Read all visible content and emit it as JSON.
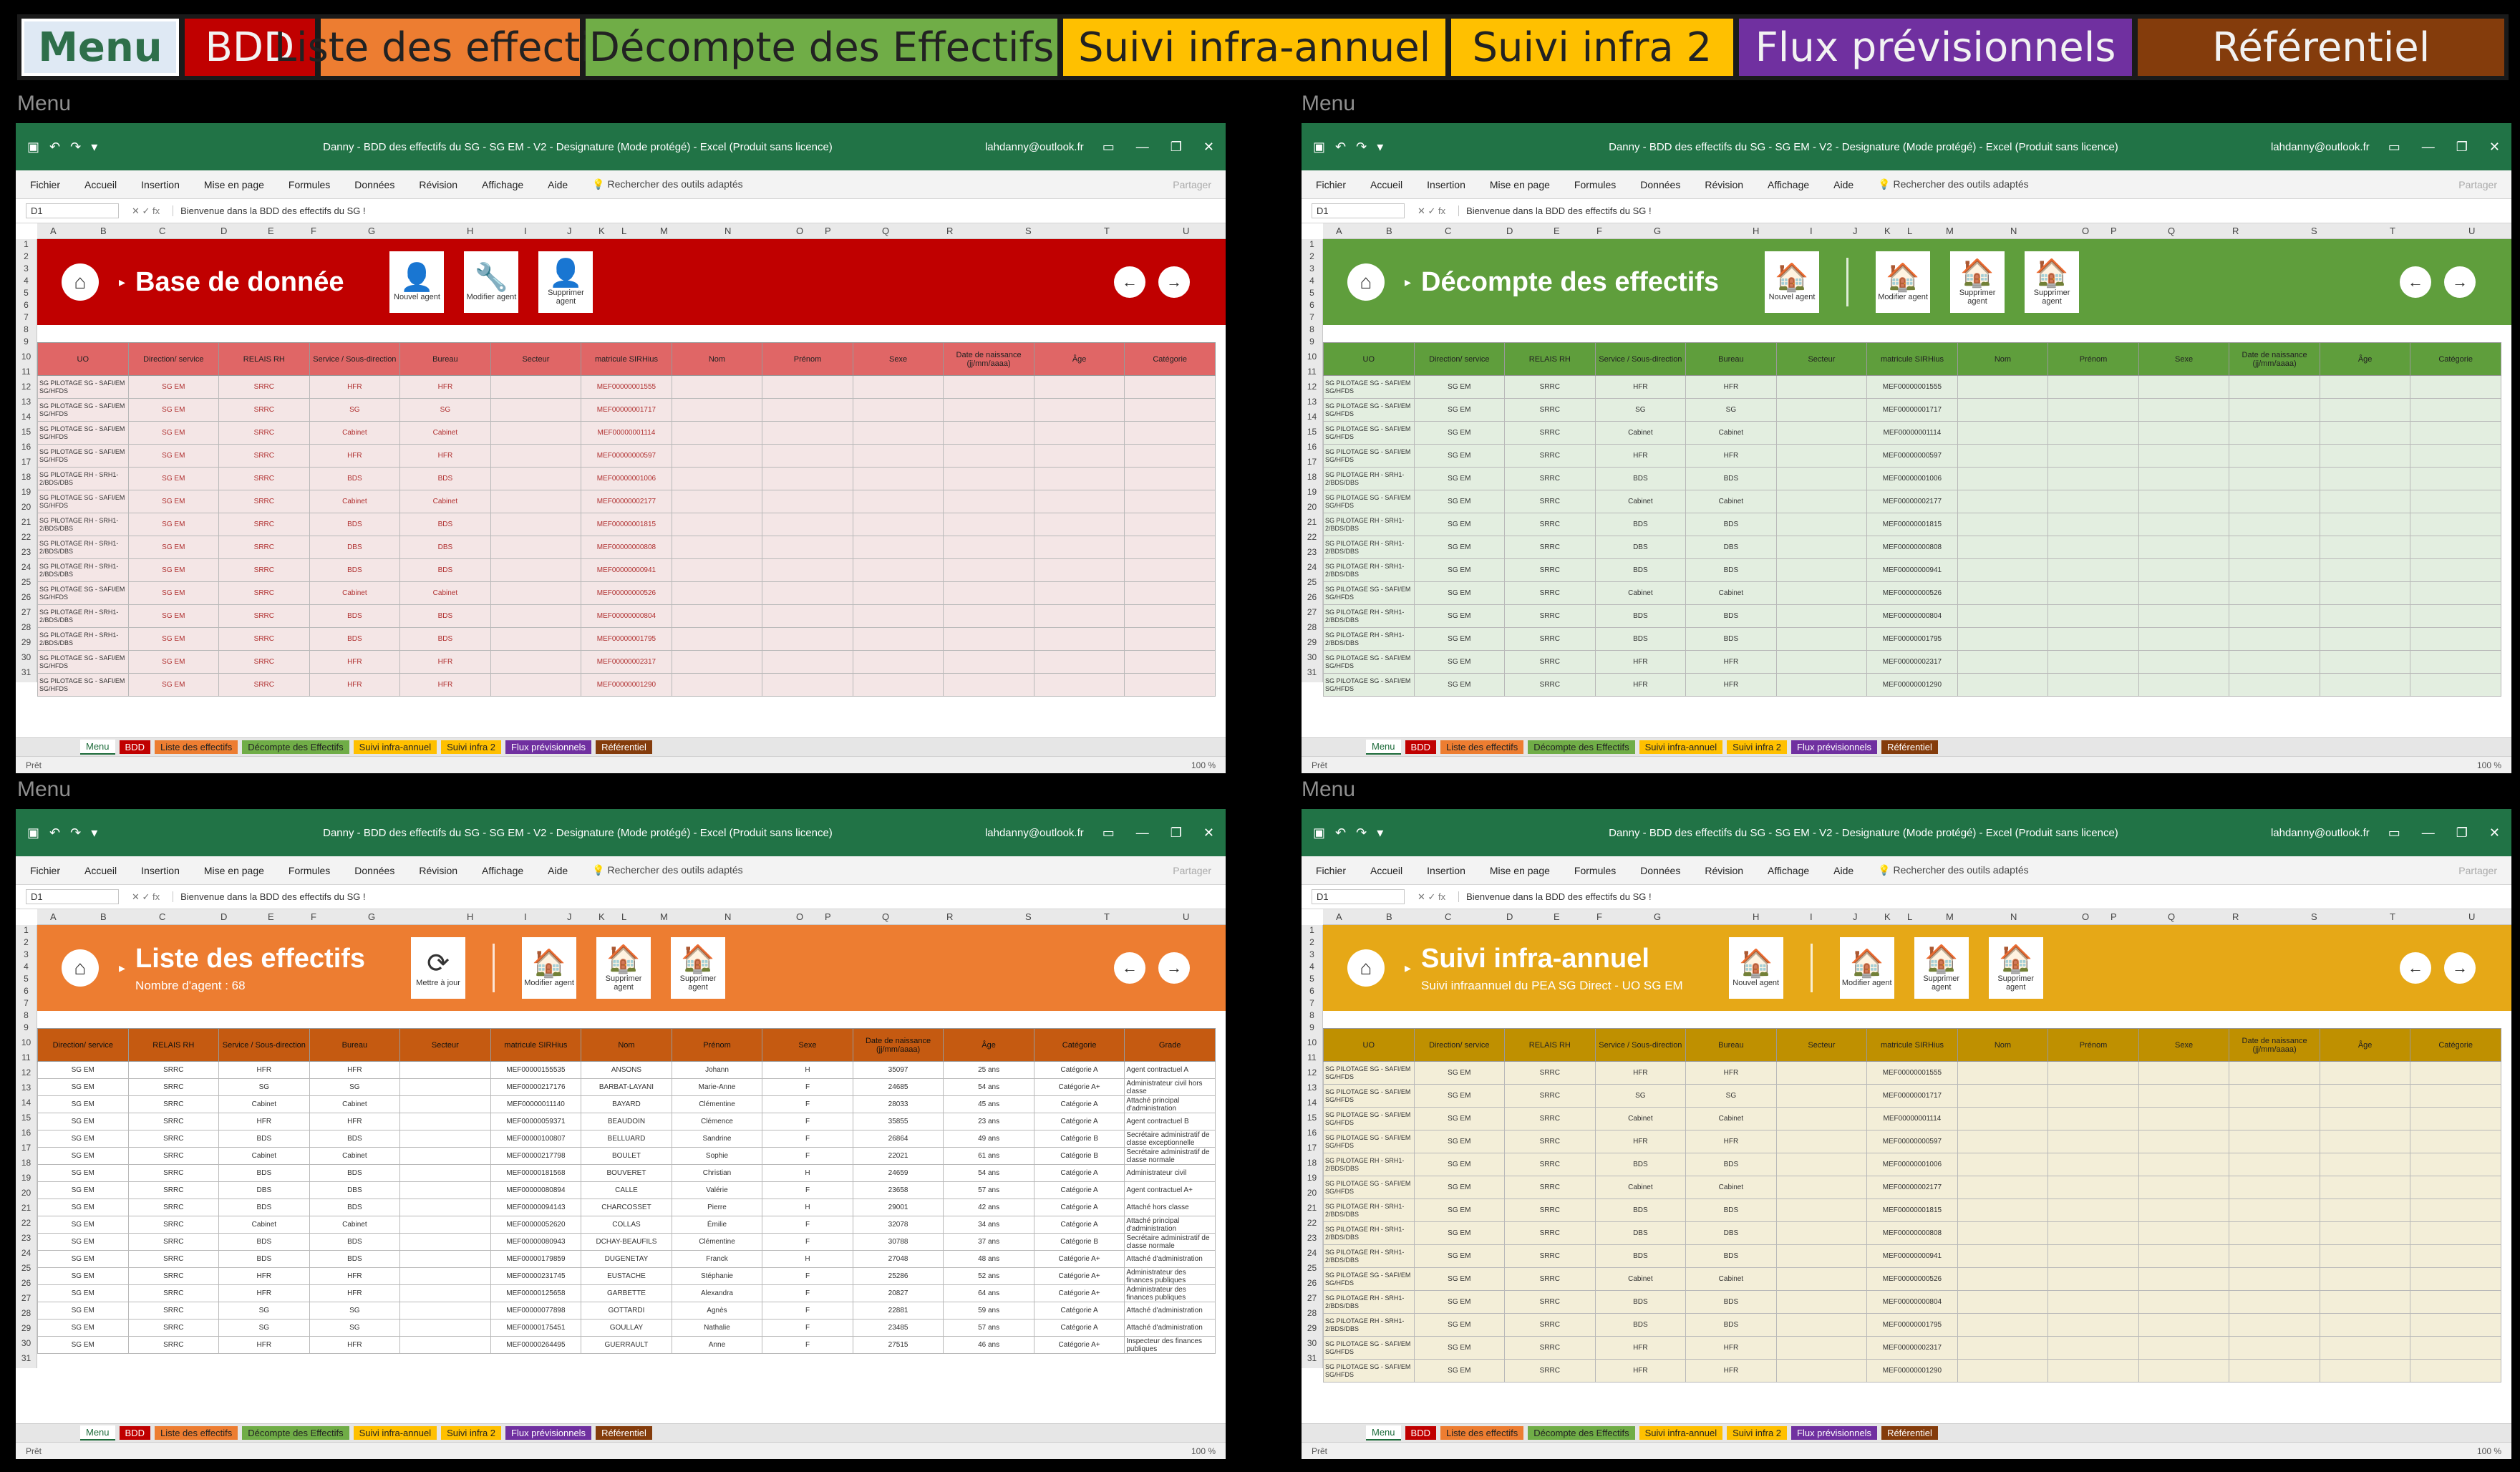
{
  "top_tabs": [
    {
      "label": "Menu",
      "color": "#dfe9f4"
    },
    {
      "label": "BDD",
      "color": "#c00000"
    },
    {
      "label": "Liste des effectifs",
      "color": "#ed7d31"
    },
    {
      "label": "Décompte des Effectifs",
      "color": "#70ad47"
    },
    {
      "label": "Suivi infra-annuel",
      "color": "#ffc000"
    },
    {
      "label": "Suivi infra 2",
      "color": "#ffc000"
    },
    {
      "label": "Flux prévisionnels",
      "color": "#7030a0"
    },
    {
      "label": "Référentiel",
      "color": "#843c0c"
    }
  ],
  "caption": "Menu",
  "window": {
    "title": "Danny - BDD des effectifs du SG - SG EM - V2 - Designature (Mode protégé) - Excel (Produit sans licence)",
    "user": "lahdanny@outlook.fr",
    "title_bar_color": "#217346",
    "ribbon": [
      "Fichier",
      "Accueil",
      "Insertion",
      "Mise en page",
      "Formules",
      "Données",
      "Révision",
      "Affichage",
      "Aide"
    ],
    "tell_me": "Rechercher des outils adaptés",
    "share": "Partager",
    "name_box": "D1",
    "formula": "Bienvenue dans la BDD des effectifs du SG !",
    "columns": [
      "A",
      "B",
      "C",
      "D",
      "E",
      "F",
      "G",
      "H",
      "I",
      "J",
      "K",
      "L",
      "M",
      "N",
      "O",
      "P",
      "Q",
      "R",
      "S",
      "T",
      "U"
    ],
    "rows": [
      "1",
      "2",
      "3",
      "4",
      "5",
      "6",
      "7",
      "8",
      "9",
      "10",
      "11",
      "12",
      "13",
      "14",
      "15",
      "16",
      "17",
      "18",
      "19",
      "20",
      "21",
      "22",
      "23",
      "24",
      "25",
      "26",
      "27",
      "28",
      "29",
      "30",
      "31"
    ],
    "sheet_tabs": [
      "Menu",
      "BDD",
      "Liste des effectifs",
      "Décompte des Effectifs",
      "Suivi infra-annuel",
      "Suivi infra 2",
      "Flux prévisionnels",
      "Référentiel"
    ],
    "status_left": "Prêt",
    "zoom": "100 %"
  },
  "panels": [
    {
      "id": "bdd",
      "accent": "#c00000",
      "head_bg": "#e06666",
      "row_bg": "#f4e6e6",
      "title": "Base de donnée",
      "subtitle": "",
      "buttons": [
        {
          "label": "Nouvel agent",
          "icon": "👤"
        },
        {
          "label": "Modifier agent",
          "icon": "🔧"
        },
        {
          "label": "Supprimer agent",
          "icon": "👤"
        }
      ],
      "headers": [
        "UO",
        "Direction/ service",
        "RELAIS RH",
        "Service / Sous-direction",
        "Bureau",
        "Secteur",
        "matricule SIRHius",
        "Nom",
        "Prénom",
        "Sexe",
        "Date de naissance (jj/mm/aaaa)",
        "Âge",
        "Catégorie"
      ]
    },
    {
      "id": "decompte",
      "accent": "#5f9e3c",
      "head_bg": "#5f9e3c",
      "row_bg": "#e3eee0",
      "title": "Décompte des effectifs",
      "subtitle": "",
      "buttons": [
        {
          "label": "Nouvel agent",
          "icon": "🏠"
        },
        {
          "label": "Modifier agent",
          "icon": "🏠"
        },
        {
          "label": "Supprimer agent",
          "icon": "🏠"
        },
        {
          "label": "Supprimer agent",
          "icon": "🏠"
        }
      ],
      "headers": [
        "UO",
        "Direction/ service",
        "RELAIS RH",
        "Service / Sous-direction",
        "Bureau",
        "Secteur",
        "matricule SIRHius",
        "Nom",
        "Prénom",
        "Sexe",
        "Date de naissance (jj/mm/aaaa)",
        "Âge",
        "Catégorie"
      ]
    },
    {
      "id": "liste",
      "accent": "#ed7d31",
      "head_bg": "#c55a11",
      "row_bg": "#ffffff",
      "title": "Liste des effectifs",
      "subtitle": "Nombre d'agent : 68",
      "buttons": [
        {
          "label": "Mettre à jour",
          "icon": "⟳"
        },
        {
          "label": "Modifier agent",
          "icon": "🏠"
        },
        {
          "label": "Supprimer agent",
          "icon": "🏠"
        },
        {
          "label": "Supprimer agent",
          "icon": "🏠"
        }
      ],
      "headers": [
        "Direction/ service",
        "RELAIS RH",
        "Service / Sous-direction",
        "Bureau",
        "Secteur",
        "matricule SIRHius",
        "Nom",
        "Prénom",
        "Sexe",
        "Date de naissance (jj/mm/aaaa)",
        "Âge",
        "Catégorie",
        "Grade"
      ]
    },
    {
      "id": "suivi",
      "accent": "#e6a817",
      "head_bg": "#bf9000",
      "row_bg": "#f3eed8",
      "title": "Suivi infra-annuel",
      "subtitle": "Suivi infraannuel du PEA SG Direct - UO SG EM",
      "buttons": [
        {
          "label": "Nouvel agent",
          "icon": "🏠"
        },
        {
          "label": "Modifier agent",
          "icon": "🏠"
        },
        {
          "label": "Supprimer agent",
          "icon": "🏠"
        },
        {
          "label": "Supprimer agent",
          "icon": "🏠"
        }
      ],
      "headers": [
        "UO",
        "Direction/ service",
        "RELAIS RH",
        "Service / Sous-direction",
        "Bureau",
        "Secteur",
        "matricule SIRHius",
        "Nom",
        "Prénom",
        "Sexe",
        "Date de naissance (jj/mm/aaaa)",
        "Âge",
        "Catégorie"
      ]
    }
  ],
  "records": [
    {
      "uo": "SG PILOTAGE SG - SAFI/EM SG/HFDS",
      "dir": "SG EM",
      "relais": "SRRC",
      "serv": "HFR",
      "bur": "HFR",
      "mat": "MEF00000001555"
    },
    {
      "uo": "SG PILOTAGE SG - SAFI/EM SG/HFDS",
      "dir": "SG EM",
      "relais": "SRRC",
      "serv": "SG",
      "bur": "SG",
      "mat": "MEF00000001717"
    },
    {
      "uo": "SG PILOTAGE SG - SAFI/EM SG/HFDS",
      "dir": "SG EM",
      "relais": "SRRC",
      "serv": "Cabinet",
      "bur": "Cabinet",
      "mat": "MEF00000001114"
    },
    {
      "uo": "SG PILOTAGE SG - SAFI/EM SG/HFDS",
      "dir": "SG EM",
      "relais": "SRRC",
      "serv": "HFR",
      "bur": "HFR",
      "mat": "MEF00000000597"
    },
    {
      "uo": "SG PILOTAGE RH - SRH1-2/BDS/DBS",
      "dir": "SG EM",
      "relais": "SRRC",
      "serv": "BDS",
      "bur": "BDS",
      "mat": "MEF00000001006"
    },
    {
      "uo": "SG PILOTAGE SG - SAFI/EM SG/HFDS",
      "dir": "SG EM",
      "relais": "SRRC",
      "serv": "Cabinet",
      "bur": "Cabinet",
      "mat": "MEF00000002177"
    },
    {
      "uo": "SG PILOTAGE RH - SRH1-2/BDS/DBS",
      "dir": "SG EM",
      "relais": "SRRC",
      "serv": "BDS",
      "bur": "BDS",
      "mat": "MEF00000001815"
    },
    {
      "uo": "SG PILOTAGE RH - SRH1-2/BDS/DBS",
      "dir": "SG EM",
      "relais": "SRRC",
      "serv": "DBS",
      "bur": "DBS",
      "mat": "MEF00000000808"
    },
    {
      "uo": "SG PILOTAGE RH - SRH1-2/BDS/DBS",
      "dir": "SG EM",
      "relais": "SRRC",
      "serv": "BDS",
      "bur": "BDS",
      "mat": "MEF00000000941"
    },
    {
      "uo": "SG PILOTAGE SG - SAFI/EM SG/HFDS",
      "dir": "SG EM",
      "relais": "SRRC",
      "serv": "Cabinet",
      "bur": "Cabinet",
      "mat": "MEF00000000526"
    },
    {
      "uo": "SG PILOTAGE RH - SRH1-2/BDS/DBS",
      "dir": "SG EM",
      "relais": "SRRC",
      "serv": "BDS",
      "bur": "BDS",
      "mat": "MEF00000000804"
    },
    {
      "uo": "SG PILOTAGE RH - SRH1-2/BDS/DBS",
      "dir": "SG EM",
      "relais": "SRRC",
      "serv": "BDS",
      "bur": "BDS",
      "mat": "MEF00000001795"
    },
    {
      "uo": "SG PILOTAGE SG - SAFI/EM SG/HFDS",
      "dir": "SG EM",
      "relais": "SRRC",
      "serv": "HFR",
      "bur": "HFR",
      "mat": "MEF00000002317"
    },
    {
      "uo": "SG PILOTAGE SG - SAFI/EM SG/HFDS",
      "dir": "SG EM",
      "relais": "SRRC",
      "serv": "HFR",
      "bur": "HFR",
      "mat": "MEF00000001290"
    }
  ],
  "liste_rows": [
    {
      "dir": "SG EM",
      "relais": "SRRC",
      "serv": "HFR",
      "bur": "HFR",
      "mat": "MEF00000155535",
      "nom": "ANSONS",
      "prenom": "Johann",
      "sexe": "H",
      "dn": "35097",
      "age": "25 ans",
      "cat": "Catégorie A",
      "grade": "Agent contractuel A"
    },
    {
      "dir": "SG EM",
      "relais": "SRRC",
      "serv": "SG",
      "bur": "SG",
      "mat": "MEF00000217176",
      "nom": "BARBAT-LAYANI",
      "prenom": "Marie-Anne",
      "sexe": "F",
      "dn": "24685",
      "age": "54 ans",
      "cat": "Catégorie A+",
      "grade": "Administrateur civil hors classe"
    },
    {
      "dir": "SG EM",
      "relais": "SRRC",
      "serv": "Cabinet",
      "bur": "Cabinet",
      "mat": "MEF00000011140",
      "nom": "BAYARD",
      "prenom": "Clémentine",
      "sexe": "F",
      "dn": "28033",
      "age": "45 ans",
      "cat": "Catégorie A",
      "grade": "Attaché principal d'administration"
    },
    {
      "dir": "SG EM",
      "relais": "SRRC",
      "serv": "HFR",
      "bur": "HFR",
      "mat": "MEF00000059371",
      "nom": "BEAUDOIN",
      "prenom": "Clémence",
      "sexe": "F",
      "dn": "35855",
      "age": "23 ans",
      "cat": "Catégorie A",
      "grade": "Agent contractuel B"
    },
    {
      "dir": "SG EM",
      "relais": "SRRC",
      "serv": "BDS",
      "bur": "BDS",
      "mat": "MEF00000100807",
      "nom": "BELLUARD",
      "prenom": "Sandrine",
      "sexe": "F",
      "dn": "26864",
      "age": "49 ans",
      "cat": "Catégorie B",
      "grade": "Secrétaire administratif de classe exceptionnelle"
    },
    {
      "dir": "SG EM",
      "relais": "SRRC",
      "serv": "Cabinet",
      "bur": "Cabinet",
      "mat": "MEF00000217798",
      "nom": "BOULET",
      "prenom": "Sophie",
      "sexe": "F",
      "dn": "22021",
      "age": "61 ans",
      "cat": "Catégorie B",
      "grade": "Secrétaire administratif de classe normale"
    },
    {
      "dir": "SG EM",
      "relais": "SRRC",
      "serv": "BDS",
      "bur": "BDS",
      "mat": "MEF00000181568",
      "nom": "BOUVERET",
      "prenom": "Christian",
      "sexe": "H",
      "dn": "24659",
      "age": "54 ans",
      "cat": "Catégorie A",
      "grade": "Administrateur civil"
    },
    {
      "dir": "SG EM",
      "relais": "SRRC",
      "serv": "DBS",
      "bur": "DBS",
      "mat": "MEF00000080894",
      "nom": "CALLE",
      "prenom": "Valérie",
      "sexe": "F",
      "dn": "23658",
      "age": "57 ans",
      "cat": "Catégorie A",
      "grade": "Agent contractuel A+"
    },
    {
      "dir": "SG EM",
      "relais": "SRRC",
      "serv": "BDS",
      "bur": "BDS",
      "mat": "MEF00000094143",
      "nom": "CHARCOSSET",
      "prenom": "Pierre",
      "sexe": "H",
      "dn": "29001",
      "age": "42 ans",
      "cat": "Catégorie A",
      "grade": "Attaché hors classe"
    },
    {
      "dir": "SG EM",
      "relais": "SRRC",
      "serv": "Cabinet",
      "bur": "Cabinet",
      "mat": "MEF00000052620",
      "nom": "COLLAS",
      "prenom": "Émilie",
      "sexe": "F",
      "dn": "32078",
      "age": "34 ans",
      "cat": "Catégorie A",
      "grade": "Attaché principal d'administration"
    },
    {
      "dir": "SG EM",
      "relais": "SRRC",
      "serv": "BDS",
      "bur": "BDS",
      "mat": "MEF00000080943",
      "nom": "DCHAY-BEAUFILS",
      "prenom": "Clémentine",
      "sexe": "F",
      "dn": "30788",
      "age": "37 ans",
      "cat": "Catégorie B",
      "grade": "Secrétaire administratif de classe normale"
    },
    {
      "dir": "SG EM",
      "relais": "SRRC",
      "serv": "BDS",
      "bur": "BDS",
      "mat": "MEF00000179859",
      "nom": "DUGENETAY",
      "prenom": "Franck",
      "sexe": "H",
      "dn": "27048",
      "age": "48 ans",
      "cat": "Catégorie A+",
      "grade": "Attaché d'administration"
    },
    {
      "dir": "SG EM",
      "relais": "SRRC",
      "serv": "HFR",
      "bur": "HFR",
      "mat": "MEF00000231745",
      "nom": "EUSTACHE",
      "prenom": "Stéphanie",
      "sexe": "F",
      "dn": "25286",
      "age": "52 ans",
      "cat": "Catégorie A+",
      "grade": "Administrateur des finances publiques"
    },
    {
      "dir": "SG EM",
      "relais": "SRRC",
      "serv": "HFR",
      "bur": "HFR",
      "mat": "MEF00000125658",
      "nom": "GARBETTE",
      "prenom": "Alexandra",
      "sexe": "F",
      "dn": "20827",
      "age": "64 ans",
      "cat": "Catégorie A+",
      "grade": "Administrateur des finances publiques"
    },
    {
      "dir": "SG EM",
      "relais": "SRRC",
      "serv": "SG",
      "bur": "SG",
      "mat": "MEF00000077898",
      "nom": "GOTTARDI",
      "prenom": "Agnès",
      "sexe": "F",
      "dn": "22881",
      "age": "59 ans",
      "cat": "Catégorie A",
      "grade": "Attaché d'administration"
    },
    {
      "dir": "SG EM",
      "relais": "SRRC",
      "serv": "SG",
      "bur": "SG",
      "mat": "MEF00000175451",
      "nom": "GOULLAY",
      "prenom": "Nathalie",
      "sexe": "F",
      "dn": "23485",
      "age": "57 ans",
      "cat": "Catégorie A",
      "grade": "Attaché d'administration"
    },
    {
      "dir": "SG EM",
      "relais": "SRRC",
      "serv": "HFR",
      "bur": "HFR",
      "mat": "MEF00000264495",
      "nom": "GUERRAULT",
      "prenom": "Anne",
      "sexe": "F",
      "dn": "27515",
      "age": "46 ans",
      "cat": "Catégorie A+",
      "grade": "Inspecteur des finances publiques"
    }
  ]
}
